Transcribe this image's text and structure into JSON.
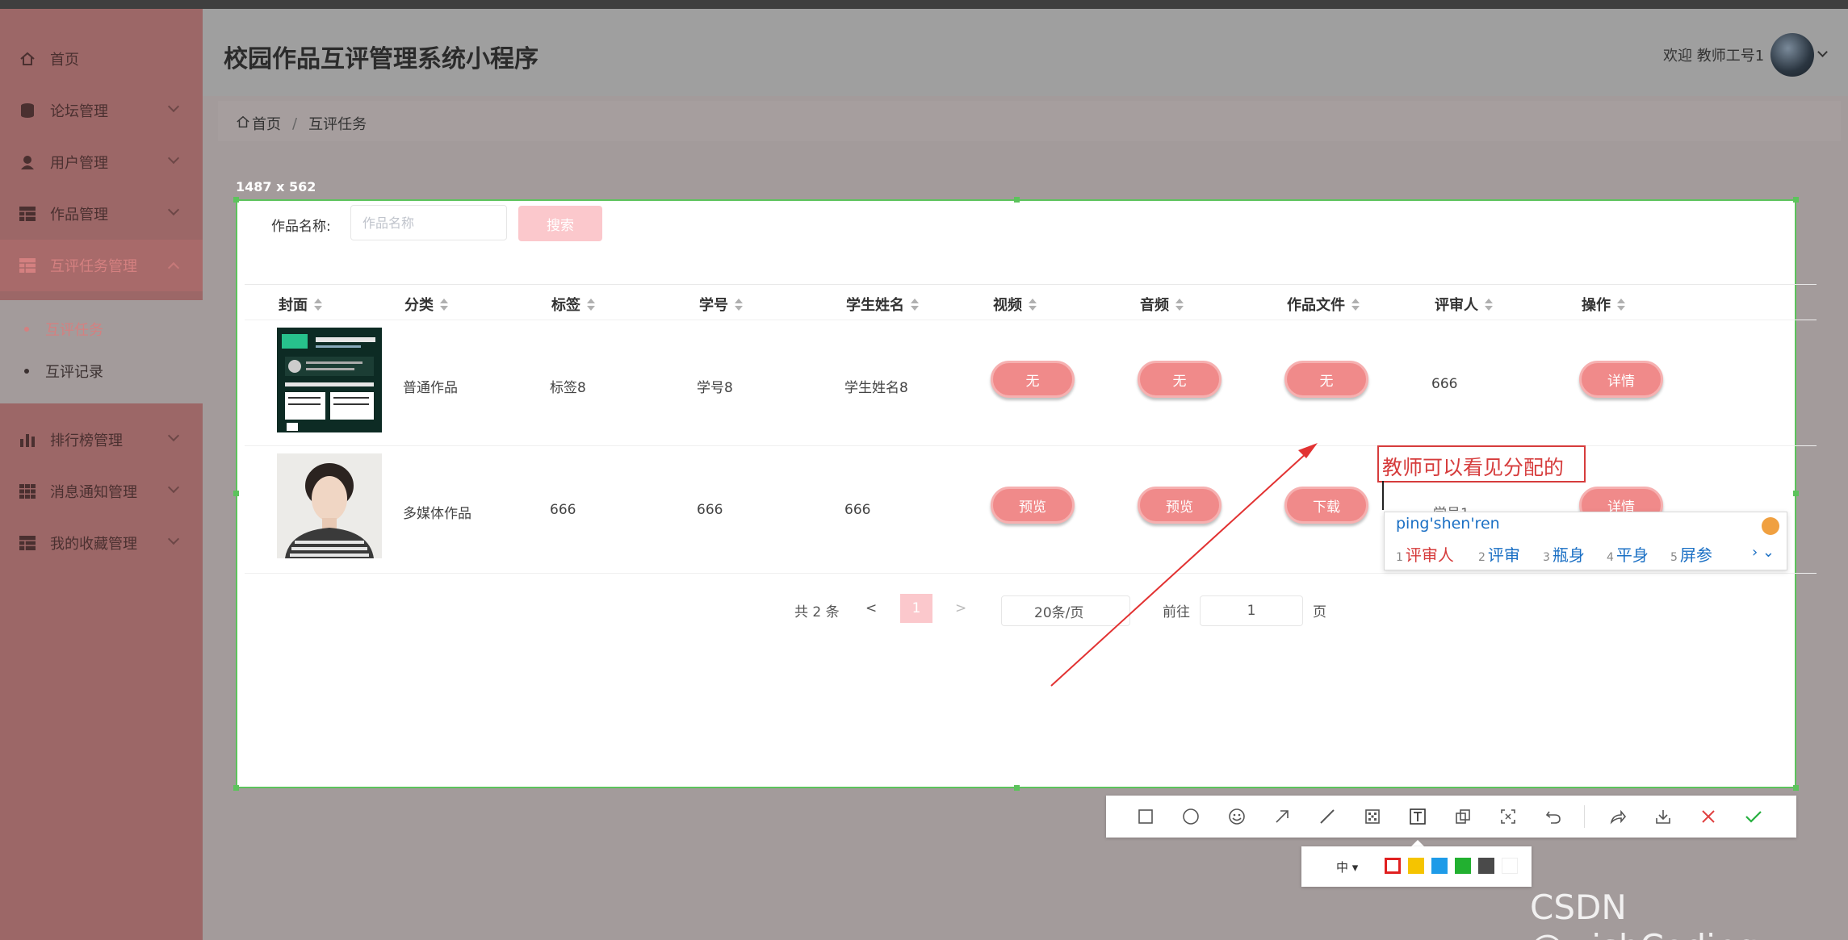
{
  "app": {
    "title": "校园作品互评管理系统小程序"
  },
  "user": {
    "welcome": "欢迎 教师工号1"
  },
  "sidebar": {
    "items": [
      {
        "label": "首页",
        "icon": "home-icon"
      },
      {
        "label": "论坛管理",
        "icon": "database-icon"
      },
      {
        "label": "用户管理",
        "icon": "user-icon"
      },
      {
        "label": "作品管理",
        "icon": "table-icon"
      },
      {
        "label": "互评任务管理",
        "icon": "table-icon"
      },
      {
        "label": "排行榜管理",
        "icon": "bar-chart-icon"
      },
      {
        "label": "消息通知管理",
        "icon": "grid-icon"
      },
      {
        "label": "我的收藏管理",
        "icon": "table-icon"
      }
    ],
    "sub_items": [
      {
        "label": "互评任务"
      },
      {
        "label": "互评记录"
      }
    ]
  },
  "breadcrumb": {
    "home": "首页",
    "current": "互评任务"
  },
  "capture": {
    "dimension_label": "1487 x 562"
  },
  "search": {
    "label": "作品名称:",
    "placeholder": "作品名称",
    "button": "搜索"
  },
  "table": {
    "columns": [
      "封面",
      "分类",
      "标签",
      "学号",
      "学生姓名",
      "视频",
      "音频",
      "作品文件",
      "评审人",
      "操作"
    ],
    "rows": [
      {
        "category": "普通作品",
        "tag": "标签8",
        "student_no": "学号8",
        "student_name": "学生姓名8",
        "video": "无",
        "audio": "无",
        "file": "无",
        "reviewer": "666",
        "action": "详情"
      },
      {
        "category": "多媒体作品",
        "tag": "666",
        "student_no": "666",
        "student_name": "666",
        "video": "预览",
        "audio": "预览",
        "file": "下载",
        "reviewer": "",
        "action": "详情"
      }
    ]
  },
  "pagination": {
    "total": "共 2 条",
    "prev": "<",
    "current": "1",
    "next": ">",
    "page_size": "20条/页",
    "goto_label": "前往",
    "goto_value": "1",
    "page_unit": "页"
  },
  "annotation": {
    "text": "教师可以看见分配的",
    "under_text": "学号1"
  },
  "ime": {
    "pinyin": "ping'shen'ren",
    "candidates": [
      {
        "n": "1",
        "word": "评审人"
      },
      {
        "n": "2",
        "word": "评审"
      },
      {
        "n": "3",
        "word": "瓶身"
      },
      {
        "n": "4",
        "word": "平身"
      },
      {
        "n": "5",
        "word": "屏参"
      }
    ]
  },
  "screenshot_toolbar": {
    "tools": [
      "rectangle-icon",
      "circle-icon",
      "emoji-icon",
      "arrow-icon",
      "line-icon",
      "mosaic-icon",
      "text-icon",
      "pin-icon",
      "ocr-icon",
      "undo-icon",
      "share-icon",
      "save-icon",
      "cancel-icon",
      "confirm-icon"
    ],
    "size_label": "中",
    "colors": [
      "#e02020",
      "#f5c400",
      "#1e9be8",
      "#22b030",
      "#4a4a4a",
      "#ffffff"
    ]
  },
  "watermark": "CSDN @wishCoding"
}
